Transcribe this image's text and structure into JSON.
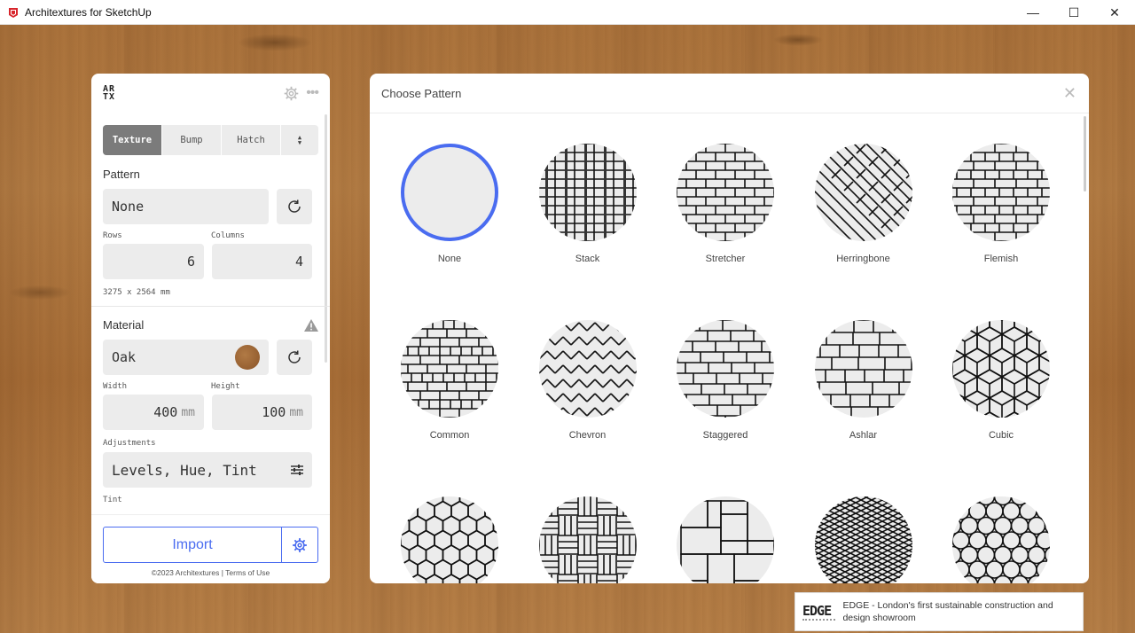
{
  "window": {
    "title": "Architextures for SketchUp",
    "minimize": "—",
    "maximize": "☐",
    "close": "✕"
  },
  "left": {
    "logo_top": "AR",
    "logo_bottom": "TX",
    "more": "•••",
    "tabs": [
      "Texture",
      "Bump",
      "Hatch"
    ],
    "tab_arrows_up": "▲",
    "tab_arrows_down": "▼",
    "pattern_label": "Pattern",
    "pattern_value": "None",
    "rows_label": "Rows",
    "columns_label": "Columns",
    "rows_value": "6",
    "columns_value": "4",
    "dimensions": "3275 x 2564 mm",
    "material_label": "Material",
    "material_value": "Oak",
    "material_swatch_color": "#9a6536",
    "width_label": "Width",
    "height_label": "Height",
    "width_value": "400",
    "height_value": "100",
    "unit": "mm",
    "adjustments_label": "Adjustments",
    "adjustments_value": "Levels, Hue, Tint",
    "partial_label": "Tint",
    "import_label": "Import",
    "footer": "©2023 Architextures | Terms of Use"
  },
  "right": {
    "title": "Choose Pattern",
    "close": "✕",
    "patterns": [
      {
        "label": "None",
        "icon": "none",
        "selected": true
      },
      {
        "label": "Stack",
        "icon": "stack"
      },
      {
        "label": "Stretcher",
        "icon": "stretcher"
      },
      {
        "label": "Herringbone",
        "icon": "herringbone"
      },
      {
        "label": "Flemish",
        "icon": "flemish"
      },
      {
        "label": "Common",
        "icon": "common"
      },
      {
        "label": "Chevron",
        "icon": "chevron"
      },
      {
        "label": "Staggered",
        "icon": "staggered"
      },
      {
        "label": "Ashlar",
        "icon": "ashlar"
      },
      {
        "label": "Cubic",
        "icon": "cubic"
      },
      {
        "label": "",
        "icon": "hexagon"
      },
      {
        "label": "",
        "icon": "basketweave"
      },
      {
        "label": "",
        "icon": "versailles"
      },
      {
        "label": "",
        "icon": "diamond"
      },
      {
        "label": "",
        "icon": "circles"
      }
    ]
  },
  "toast": {
    "logo": "EDGE",
    "text": "EDGE - London's first sustainable construction and design showroom"
  },
  "colors": {
    "accent": "#4a6cf0",
    "active_tab": "#7b7b7b",
    "field_bg": "#ececec"
  }
}
